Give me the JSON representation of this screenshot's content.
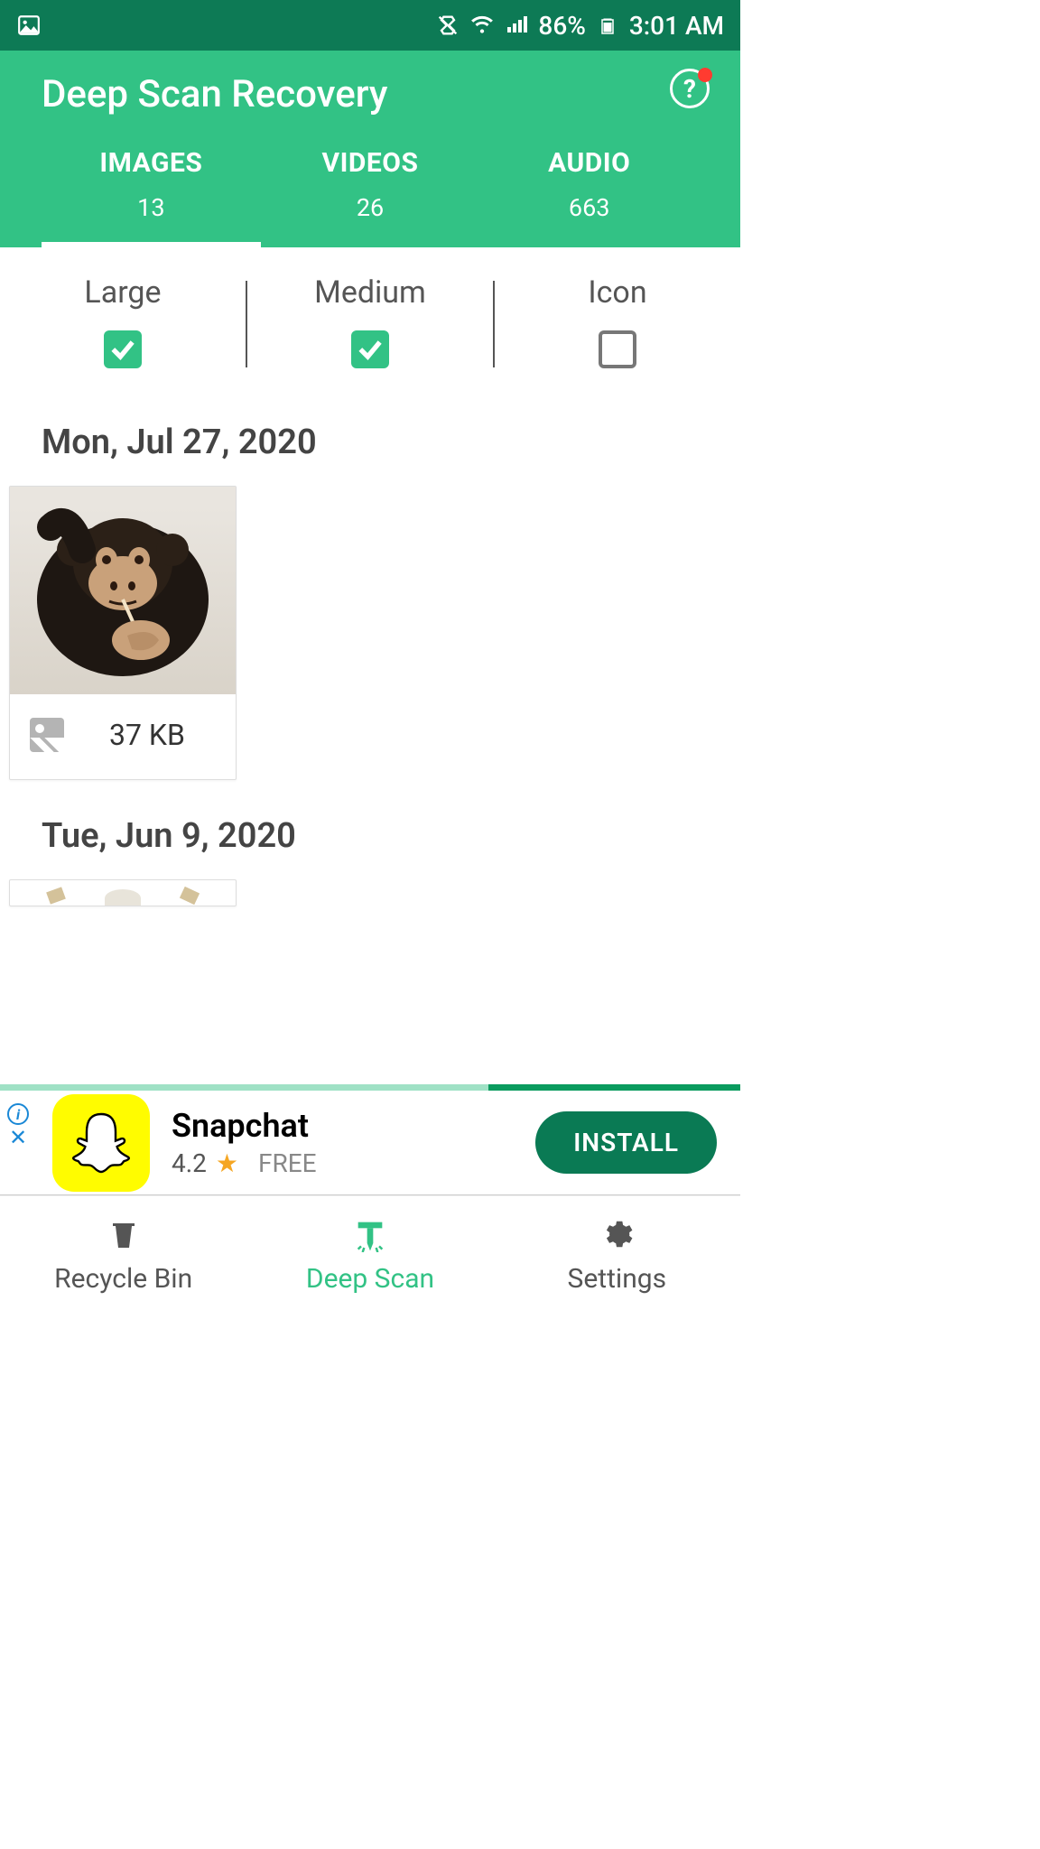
{
  "status": {
    "battery": "86%",
    "time": "3:01 AM"
  },
  "header": {
    "title": "Deep Scan Recovery"
  },
  "tabs": [
    {
      "label": "IMAGES",
      "count": "13",
      "active": true
    },
    {
      "label": "VIDEOS",
      "count": "26",
      "active": false
    },
    {
      "label": "AUDIO",
      "count": "663",
      "active": false
    }
  ],
  "filters": [
    {
      "label": "Large",
      "checked": true
    },
    {
      "label": "Medium",
      "checked": true
    },
    {
      "label": "Icon",
      "checked": false
    }
  ],
  "groups": [
    {
      "date": "Mon, Jul 27, 2020",
      "items": [
        {
          "size": "37 KB"
        }
      ]
    },
    {
      "date": "Tue, Jun 9, 2020",
      "items": [
        {
          "size": ""
        }
      ]
    }
  ],
  "progress": {
    "percent": 35
  },
  "ad": {
    "title": "Snapchat",
    "rating": "4.2",
    "price": "FREE",
    "cta": "INSTALL"
  },
  "nav": [
    {
      "label": "Recycle Bin",
      "active": false
    },
    {
      "label": "Deep Scan",
      "active": true
    },
    {
      "label": "Settings",
      "active": false
    }
  ]
}
